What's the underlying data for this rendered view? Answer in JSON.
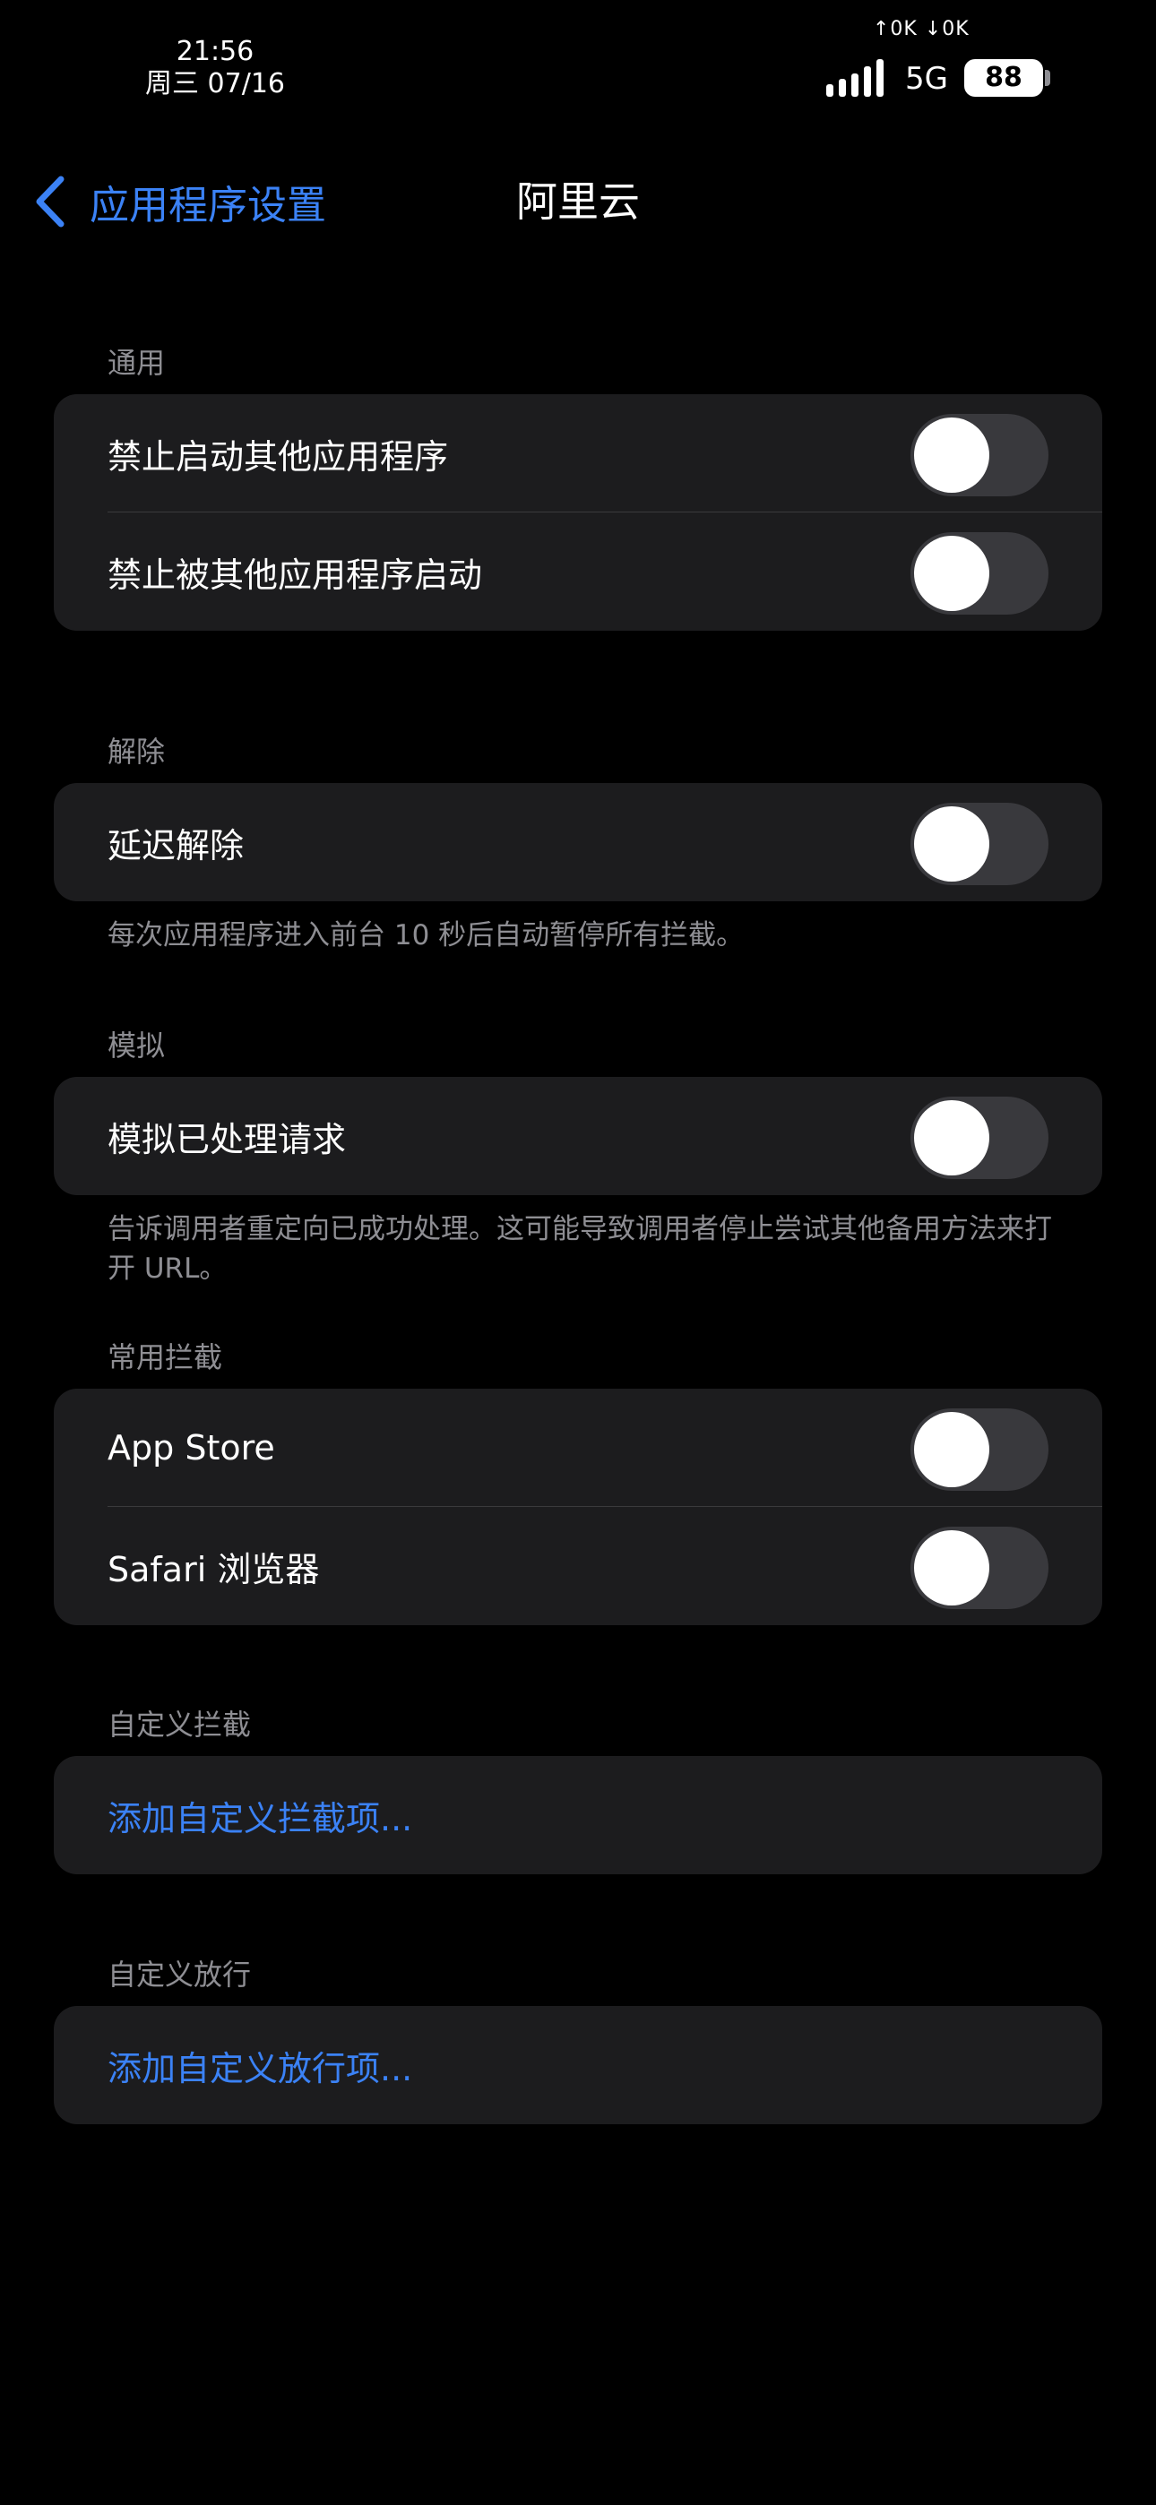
{
  "status_bar": {
    "time": "21:56",
    "date": "周三 07/16",
    "net_speed": "↑0K ↓0K",
    "network": "5G",
    "battery": "88"
  },
  "nav": {
    "back_label": "应用程序设置",
    "title": "阿里云"
  },
  "sections": {
    "general": {
      "header": "通用",
      "rows": [
        {
          "label": "禁止启动其他应用程序",
          "on": false
        },
        {
          "label": "禁止被其他应用程序启动",
          "on": false
        }
      ]
    },
    "release": {
      "header": "解除",
      "rows": [
        {
          "label": "延迟解除",
          "on": false
        }
      ],
      "footnote": "每次应用程序进入前台 10 秒后自动暂停所有拦截。"
    },
    "simulate": {
      "header": "模拟",
      "rows": [
        {
          "label": "模拟已处理请求",
          "on": false
        }
      ],
      "footnote": "告诉调用者重定向已成功处理。这可能导致调用者停止尝试其他备用方法来打开 URL。"
    },
    "common": {
      "header": "常用拦截",
      "rows": [
        {
          "label": "App Store",
          "on": false
        },
        {
          "label": "Safari 浏览器",
          "on": false
        }
      ]
    },
    "custom_block": {
      "header": "自定义拦截",
      "action": "添加自定义拦截项..."
    },
    "custom_allow": {
      "header": "自定义放行",
      "action": "添加自定义放行项..."
    }
  },
  "colors": {
    "background": "#000000",
    "card": "#1c1c1e",
    "accent": "#3b82f6",
    "secondary_text": "#8e8e93",
    "toggle_off": "#39393d"
  }
}
